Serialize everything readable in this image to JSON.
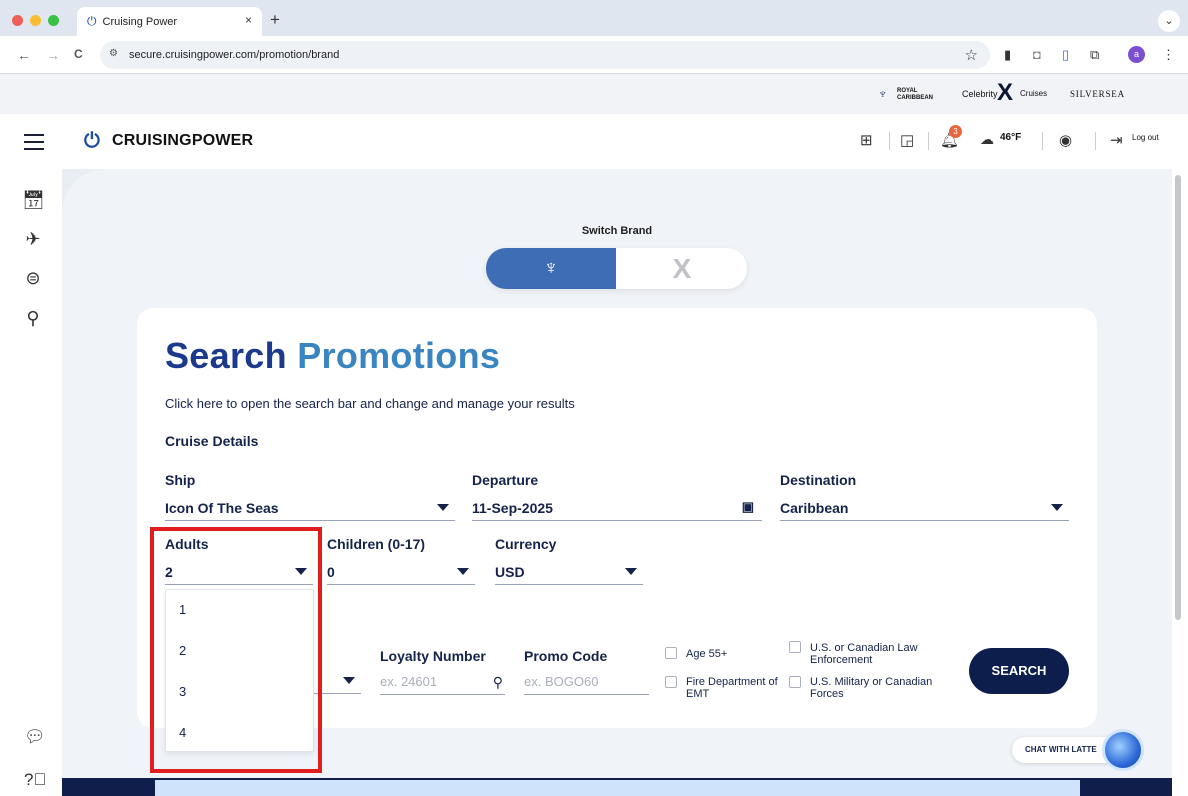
{
  "browser": {
    "tab_title": "Cruising Power",
    "tab_close": "×",
    "new_tab": "+",
    "url": "secure.cruisingpower.com/promotion/brand",
    "back": "←",
    "forward": "→",
    "reload": "C",
    "star": "☆",
    "menu": "⋮",
    "profile_initial": "a"
  },
  "brand_logos": {
    "royal": "ROYAL CARIBBEAN",
    "celebrity": "Celebrity",
    "celebrity_x": "X",
    "celebrity_suffix": "Cruises",
    "silversea": "SILVERSEA"
  },
  "header": {
    "logo_text": "CRUISINGPOWER",
    "notif_count": "3",
    "weather": "46°F",
    "logout_label": "Log out"
  },
  "switch_brand": {
    "label": "Switch Brand",
    "brand_on_icon": "♆",
    "brand_off_icon": "X"
  },
  "search": {
    "title_part1": "Search",
    "title_part2": "Promotions",
    "subtitle": "Click here to open the search bar and change and manage your results",
    "section": "Cruise Details",
    "ship_label": "Ship",
    "ship_value": "Icon Of The Seas",
    "departure_label": "Departure",
    "departure_value": "11-Sep-2025",
    "destination_label": "Destination",
    "destination_value": "Caribbean",
    "adults_label": "Adults",
    "adults_value": "2",
    "children_label": "Children (0-17)",
    "children_value": "0",
    "currency_label": "Currency",
    "currency_value": "USD",
    "adult_options": [
      "1",
      "2",
      "3",
      "4"
    ],
    "loyalty_label": "Loyalty Number",
    "loyalty_placeholder": "ex. 24601",
    "promo_label": "Promo Code",
    "promo_placeholder": "ex. BOGO60",
    "checkbox_age": "Age 55+",
    "checkbox_fire": "Fire Department of EMT",
    "checkbox_law": "U.S. or Canadian Law Enforcement",
    "checkbox_military": "U.S. Military or Canadian Forces",
    "search_button": "SEARCH"
  },
  "chat": {
    "label": "CHAT WITH LATTE"
  }
}
